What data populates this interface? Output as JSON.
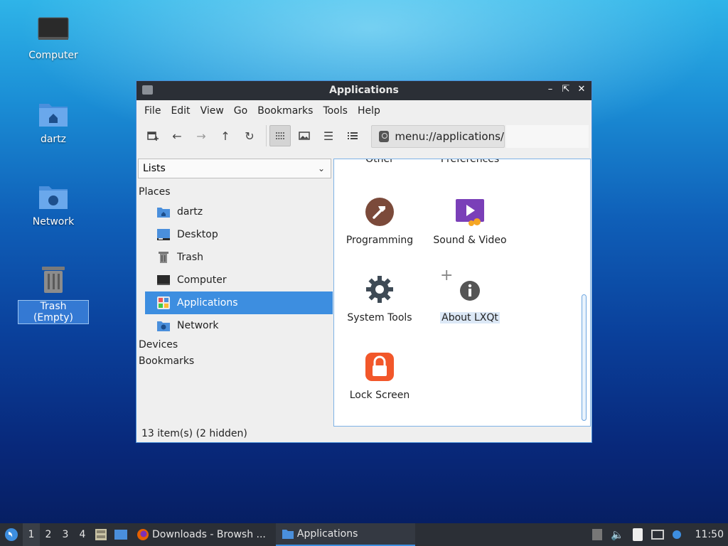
{
  "desktop": {
    "icons": [
      {
        "label": "Computer"
      },
      {
        "label": "dartz"
      },
      {
        "label": "Network"
      },
      {
        "label": "Trash (Empty)"
      }
    ]
  },
  "window": {
    "title": "Applications",
    "menu": [
      "File",
      "Edit",
      "View",
      "Go",
      "Bookmarks",
      "Tools",
      "Help"
    ],
    "path": "menu://applications/",
    "sidebar": {
      "mode": "Lists",
      "places_header": "Places",
      "places": [
        {
          "label": "dartz"
        },
        {
          "label": "Desktop"
        },
        {
          "label": "Trash"
        },
        {
          "label": "Computer"
        },
        {
          "label": "Applications"
        },
        {
          "label": "Network"
        }
      ],
      "devices_header": "Devices",
      "bookmarks_header": "Bookmarks"
    },
    "items": [
      {
        "label": "Other"
      },
      {
        "label": "Preferences"
      },
      {
        "label": "Programming"
      },
      {
        "label": "Sound & Video"
      },
      {
        "label": "System Tools"
      },
      {
        "label": "About LXQt"
      },
      {
        "label": "Lock Screen"
      }
    ],
    "status": "13 item(s) (2 hidden)"
  },
  "taskbar": {
    "workspaces": [
      "1",
      "2",
      "3",
      "4"
    ],
    "tasks": [
      {
        "label": "Downloads - Browsh ..."
      },
      {
        "label": "Applications"
      }
    ],
    "clock": "11:50"
  },
  "colors": {
    "accent": "#3d8ee0",
    "titlebar": "#2b2f36"
  }
}
